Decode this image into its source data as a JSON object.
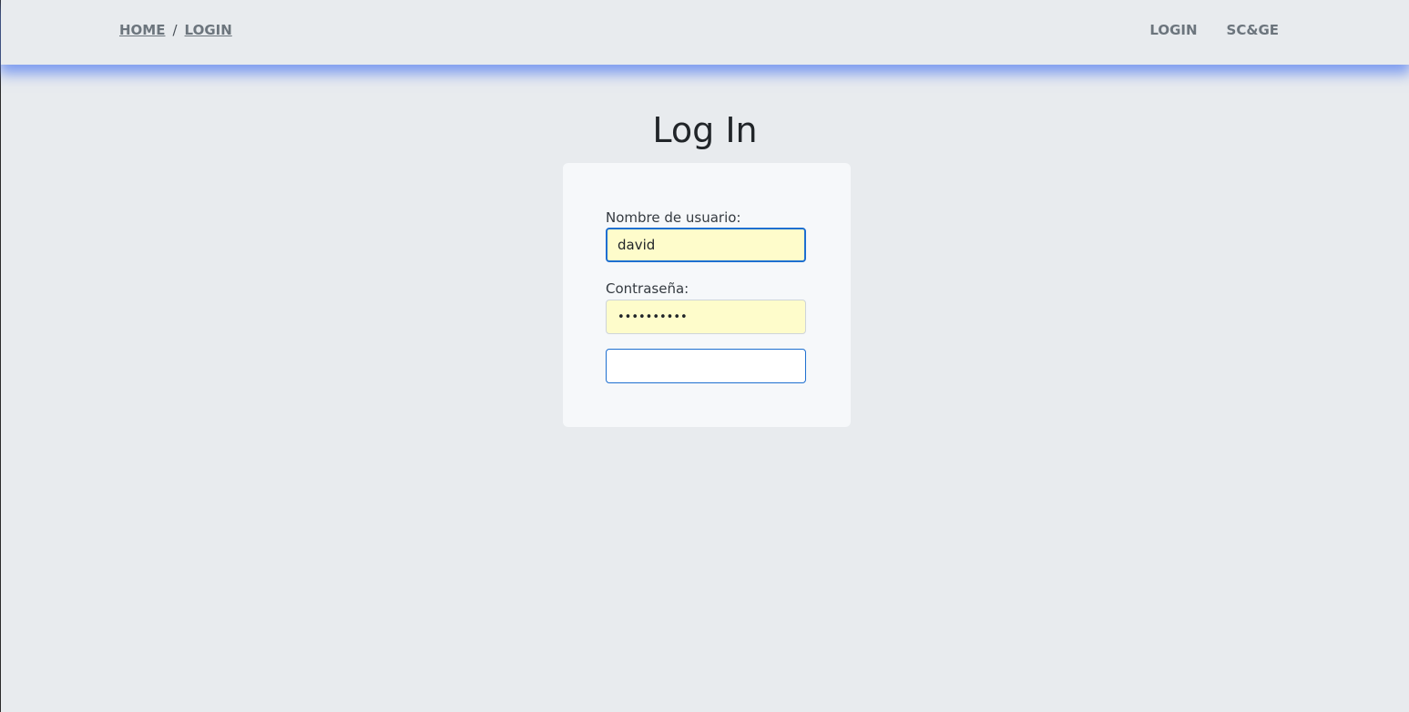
{
  "breadcrumb": {
    "home": "HOME",
    "separator": "/",
    "current": "LOGIN"
  },
  "nav": {
    "login": "LOGIN",
    "brand": "SC&GE"
  },
  "page": {
    "title": "Log In"
  },
  "form": {
    "username_label": "Nombre de usuario:",
    "username_value": "david",
    "password_label": "Contraseña:",
    "password_value": "••••••••••",
    "submit_label": ""
  },
  "colors": {
    "background": "#e8ebee",
    "card": "#f6f8fa",
    "autofill": "#fefccb",
    "accent": "#1e6fd0",
    "header_shadow": "#5a82f0"
  }
}
